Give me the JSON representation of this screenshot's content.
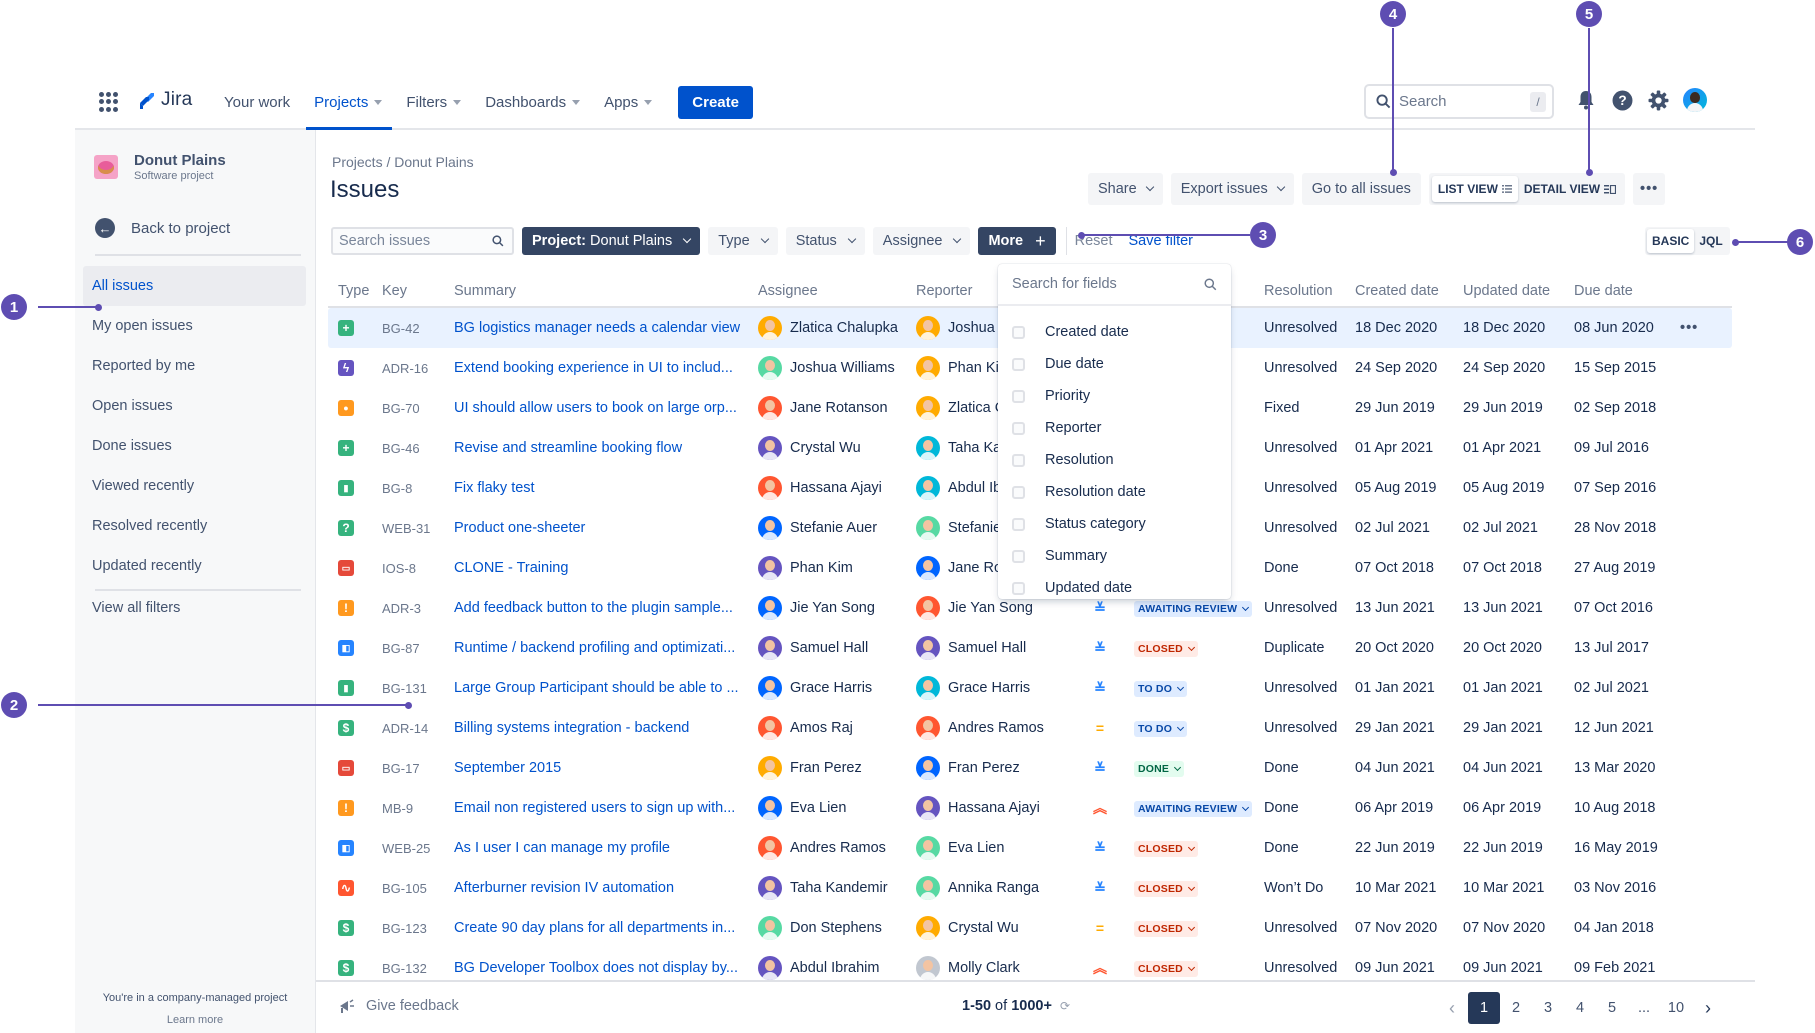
{
  "nav": {
    "app_name": "Jira",
    "items": [
      {
        "label": "Your work",
        "caret": false,
        "active": false
      },
      {
        "label": "Projects",
        "caret": true,
        "active": true
      },
      {
        "label": "Filters",
        "caret": true,
        "active": false
      },
      {
        "label": "Dashboards",
        "caret": true,
        "active": false
      },
      {
        "label": "Apps",
        "caret": true,
        "active": false
      }
    ],
    "create_label": "Create",
    "search_placeholder": "Search",
    "search_shortcut": "/",
    "icons": [
      "bell-icon",
      "help-icon",
      "settings-icon",
      "user-avatar"
    ]
  },
  "sidebar": {
    "project_name": "Donut Plains",
    "project_type": "Software project",
    "back_label": "Back to project",
    "items": [
      {
        "label": "All issues",
        "active": true
      },
      {
        "label": "My open issues",
        "active": false
      },
      {
        "label": "Reported by me",
        "active": false
      },
      {
        "label": "Open issues",
        "active": false
      },
      {
        "label": "Done issues",
        "active": false
      },
      {
        "label": "Viewed recently",
        "active": false
      },
      {
        "label": "Resolved recently",
        "active": false
      },
      {
        "label": "Updated recently",
        "active": false
      }
    ],
    "view_all_filters": "View all filters",
    "footer_text": "You're in a company-managed project",
    "learn_more": "Learn more"
  },
  "header": {
    "breadcrumb": "Projects / Donut Plains",
    "title": "Issues",
    "share_label": "Share",
    "export_label": "Export issues",
    "go_all_label": "Go to all issues",
    "list_view_label": "LIST VIEW",
    "detail_view_label": "DETAIL VIEW",
    "more_label": "•••"
  },
  "filters": {
    "search_placeholder": "Search issues",
    "project_label_bold": "Project:",
    "project_value": "Donut Plains",
    "type_label": "Type",
    "status_label": "Status",
    "assignee_label": "Assignee",
    "more_label": "More",
    "reset_label": "Reset",
    "save_filter_label": "Save filter",
    "basic_label": "BASIC",
    "jql_label": "JQL"
  },
  "more_dropdown": {
    "search_placeholder": "Search for fields",
    "options": [
      {
        "label": "Created date",
        "checked": false
      },
      {
        "label": "Due date",
        "checked": false
      },
      {
        "label": "Priority",
        "checked": false
      },
      {
        "label": "Reporter",
        "checked": false
      },
      {
        "label": "Resolution",
        "checked": false
      },
      {
        "label": "Resolution date",
        "checked": false
      },
      {
        "label": "Status category",
        "checked": false
      },
      {
        "label": "Summary",
        "checked": false
      },
      {
        "label": "Updated date",
        "checked": false
      }
    ]
  },
  "table": {
    "columns": [
      "Type",
      "Key",
      "Summary",
      "Assignee",
      "Reporter",
      "",
      "",
      "Resolution",
      "Created date",
      "Updated date",
      "Due date"
    ],
    "type_styles": {
      "story": {
        "color": "#36B37E",
        "glyph": "+"
      },
      "epic": {
        "color": "#6554C0",
        "glyph": "ϟ"
      },
      "idea": {
        "color": "#FF991F",
        "glyph": "●"
      },
      "bookmark": {
        "color": "#36B37E",
        "glyph": "▮"
      },
      "question": {
        "color": "#36B37E",
        "glyph": "?"
      },
      "bug": {
        "color": "#E5493A",
        "glyph": "▭"
      },
      "warning": {
        "color": "#FF991F",
        "glyph": "!"
      },
      "subtask": {
        "color": "#2684FF",
        "glyph": "◧"
      },
      "billing": {
        "color": "#36B37E",
        "glyph": "$"
      },
      "incident": {
        "color": "#FF5630",
        "glyph": "∿"
      }
    },
    "priority_styles": {
      "lowest": {
        "glyph": "≚",
        "color": "#2684FF"
      },
      "medium": {
        "glyph": "=",
        "color": "#FFAB00"
      },
      "highest": {
        "glyph": "︽",
        "color": "#FF5630"
      }
    },
    "status_styles": {
      "AWAITING REVIEW": {
        "bg": "#DEEBFF",
        "fg": "#0747A6"
      },
      "CLOSED": {
        "bg": "#FFEBE6",
        "fg": "#BF2600"
      },
      "TO DO": {
        "bg": "#DEEBFF",
        "fg": "#0747A6"
      },
      "DONE": {
        "bg": "#E3FCEF",
        "fg": "#006644"
      }
    },
    "rows": [
      {
        "type": "story",
        "key": "BG-42",
        "summary": "BG logistics manager needs a calendar view",
        "assignee": "Zlatica Chalupka",
        "assignee_color": "#FFAB00",
        "reporter": "Joshua Williams",
        "reporter_color": "#FFAB00",
        "priority": "",
        "status": "",
        "resolution": "Unresolved",
        "created": "18 Dec 2020",
        "updated": "18 Dec 2020",
        "due": "08 Jun 2020",
        "selected": true
      },
      {
        "type": "epic",
        "key": "ADR-16",
        "summary": "Extend booking experience in UI to includ...",
        "assignee": "Joshua Williams",
        "assignee_color": "#57D9A3",
        "reporter": "Phan Kim",
        "reporter_color": "#FFAB00",
        "priority": "",
        "status": "",
        "resolution": "Unresolved",
        "created": "24 Sep 2020",
        "updated": "24 Sep 2020",
        "due": "15 Sep 2015"
      },
      {
        "type": "idea",
        "key": "BG-70",
        "summary": "UI should allow users to book on large orp...",
        "assignee": "Jane Rotanson",
        "assignee_color": "#FF5630",
        "reporter": "Zlatica Chalupka",
        "reporter_color": "#FFAB00",
        "priority": "",
        "status": "",
        "resolution": "Fixed",
        "created": "29 Jun 2019",
        "updated": "29 Jun 2019",
        "due": "02 Sep 2018"
      },
      {
        "type": "story",
        "key": "BG-46",
        "summary": "Revise and streamline booking flow",
        "assignee": "Crystal Wu",
        "assignee_color": "#6554C0",
        "reporter": "Taha Kandemir",
        "reporter_color": "#00B8D9",
        "priority": "",
        "status": "",
        "resolution": "Unresolved",
        "created": "01 Apr 2021",
        "updated": "01 Apr 2021",
        "due": "09 Jul 2016"
      },
      {
        "type": "bookmark",
        "key": "BG-8",
        "summary": "Fix flaky test",
        "assignee": "Hassana Ajayi",
        "assignee_color": "#FF5630",
        "reporter": "Abdul Ibrahim",
        "reporter_color": "#00B8D9",
        "priority": "",
        "status": "",
        "resolution": "Unresolved",
        "created": "05 Aug 2019",
        "updated": "05 Aug 2019",
        "due": "07 Sep 2016"
      },
      {
        "type": "question",
        "key": "WEB-31",
        "summary": "Product one-sheeter",
        "assignee": "Stefanie Auer",
        "assignee_color": "#0065FF",
        "reporter": "Stefanie Auer",
        "reporter_color": "#57D9A3",
        "priority": "",
        "status": "",
        "resolution": "Unresolved",
        "created": "02 Jul 2021",
        "updated": "02 Jul 2021",
        "due": "28 Nov 2018"
      },
      {
        "type": "bug",
        "key": "IOS-8",
        "summary": "CLONE - Training",
        "assignee": "Phan Kim",
        "assignee_color": "#6554C0",
        "reporter": "Jane Rotanson",
        "reporter_color": "#0065FF",
        "priority": "",
        "status": "",
        "resolution": "Done",
        "created": "07 Oct 2018",
        "updated": "07 Oct 2018",
        "due": "27 Aug 2019"
      },
      {
        "type": "warning",
        "key": "ADR-3",
        "summary": "Add feedback button to the plugin sample...",
        "assignee": "Jie Yan Song",
        "assignee_color": "#0065FF",
        "reporter": "Jie Yan Song",
        "reporter_color": "#FF5630",
        "priority": "lowest",
        "status": "AWAITING REVIEW",
        "resolution": "Unresolved",
        "created": "13 Jun 2021",
        "updated": "13 Jun 2021",
        "due": "07 Oct 2016"
      },
      {
        "type": "subtask",
        "key": "BG-87",
        "summary": "Runtime / backend profiling and optimizati...",
        "assignee": "Samuel Hall",
        "assignee_color": "#6554C0",
        "reporter": "Samuel Hall",
        "reporter_color": "#6554C0",
        "priority": "lowest",
        "status": "CLOSED",
        "resolution": "Duplicate",
        "created": "20 Oct 2020",
        "updated": "20 Oct 2020",
        "due": "13 Jul 2017"
      },
      {
        "type": "bookmark",
        "key": "BG-131",
        "summary": "Large Group Participant should be able to ...",
        "assignee": "Grace Harris",
        "assignee_color": "#0065FF",
        "reporter": "Grace Harris",
        "reporter_color": "#00B8D9",
        "priority": "lowest",
        "status": "TO DO",
        "resolution": "Unresolved",
        "created": "01 Jan 2021",
        "updated": "01 Jan 2021",
        "due": "02 Jul 2021"
      },
      {
        "type": "billing",
        "key": "ADR-14",
        "summary": "Billing systems integration - backend",
        "assignee": "Amos Raj",
        "assignee_color": "#FF5630",
        "reporter": "Andres Ramos",
        "reporter_color": "#FF5630",
        "priority": "medium",
        "status": "TO DO",
        "resolution": "Unresolved",
        "created": "29 Jan 2021",
        "updated": "29 Jan 2021",
        "due": "12 Jun 2021"
      },
      {
        "type": "bug",
        "key": "BG-17",
        "summary": "September 2015",
        "assignee": "Fran Perez",
        "assignee_color": "#FFAB00",
        "reporter": "Fran Perez",
        "reporter_color": "#0065FF",
        "priority": "lowest",
        "status": "DONE",
        "resolution": "Done",
        "created": "04 Jun 2021",
        "updated": "04 Jun 2021",
        "due": "13 Mar 2020"
      },
      {
        "type": "warning",
        "key": "MB-9",
        "summary": "Email non registered users to sign up with...",
        "assignee": "Eva Lien",
        "assignee_color": "#0065FF",
        "reporter": "Hassana Ajayi",
        "reporter_color": "#6554C0",
        "priority": "highest",
        "status": "AWAITING REVIEW",
        "resolution": "Done",
        "created": "06 Apr 2019",
        "updated": "06 Apr 2019",
        "due": "10 Aug 2018"
      },
      {
        "type": "subtask",
        "key": "WEB-25",
        "summary": "As I user I can manage my profile",
        "assignee": "Andres Ramos",
        "assignee_color": "#FF5630",
        "reporter": "Eva Lien",
        "reporter_color": "#57D9A3",
        "priority": "lowest",
        "status": "CLOSED",
        "resolution": "Done",
        "created": "22 Jun 2019",
        "updated": "22 Jun 2019",
        "due": "16 May 2019"
      },
      {
        "type": "incident",
        "key": "BG-105",
        "summary": "Afterburner revision IV automation",
        "assignee": "Taha Kandemir",
        "assignee_color": "#6554C0",
        "reporter": "Annika Ranga",
        "reporter_color": "#57D9A3",
        "priority": "lowest",
        "status": "CLOSED",
        "resolution": "Won’t Do",
        "created": "10 Mar 2021",
        "updated": "10 Mar 2021",
        "due": "03 Nov 2016"
      },
      {
        "type": "billing",
        "key": "BG-123",
        "summary": "Create 90 day plans for all departments in...",
        "assignee": "Don Stephens",
        "assignee_color": "#57D9A3",
        "reporter": "Crystal Wu",
        "reporter_color": "#FFAB00",
        "priority": "medium",
        "status": "CLOSED",
        "resolution": "Unresolved",
        "created": "07 Nov 2020",
        "updated": "07 Nov 2020",
        "due": "04 Jan 2018"
      },
      {
        "type": "billing",
        "key": "BG-132",
        "summary": "BG Developer Toolbox does not display by...",
        "assignee": "Abdul Ibrahim",
        "assignee_color": "#6554C0",
        "reporter": "Molly Clark",
        "reporter_color": "#C1C7D0",
        "priority": "highest",
        "status": "CLOSED",
        "resolution": "Unresolved",
        "created": "09 Jun 2021",
        "updated": "09 Jun 2021",
        "due": "09 Feb 2021"
      }
    ],
    "row_actions_label": "•••"
  },
  "footer": {
    "feedback_label": "Give feedback",
    "count_bold": "1-50",
    "count_rest": " of ",
    "count_total": "1000+",
    "pages": [
      "1",
      "2",
      "3",
      "4",
      "5",
      "...",
      "10"
    ],
    "current_page": "1"
  },
  "callouts": [
    "1",
    "2",
    "3",
    "4",
    "5",
    "6"
  ],
  "colors": {
    "brand_blue": "#0052CC",
    "callout_purple": "#5E4DB2",
    "dark_button": "#344563"
  }
}
